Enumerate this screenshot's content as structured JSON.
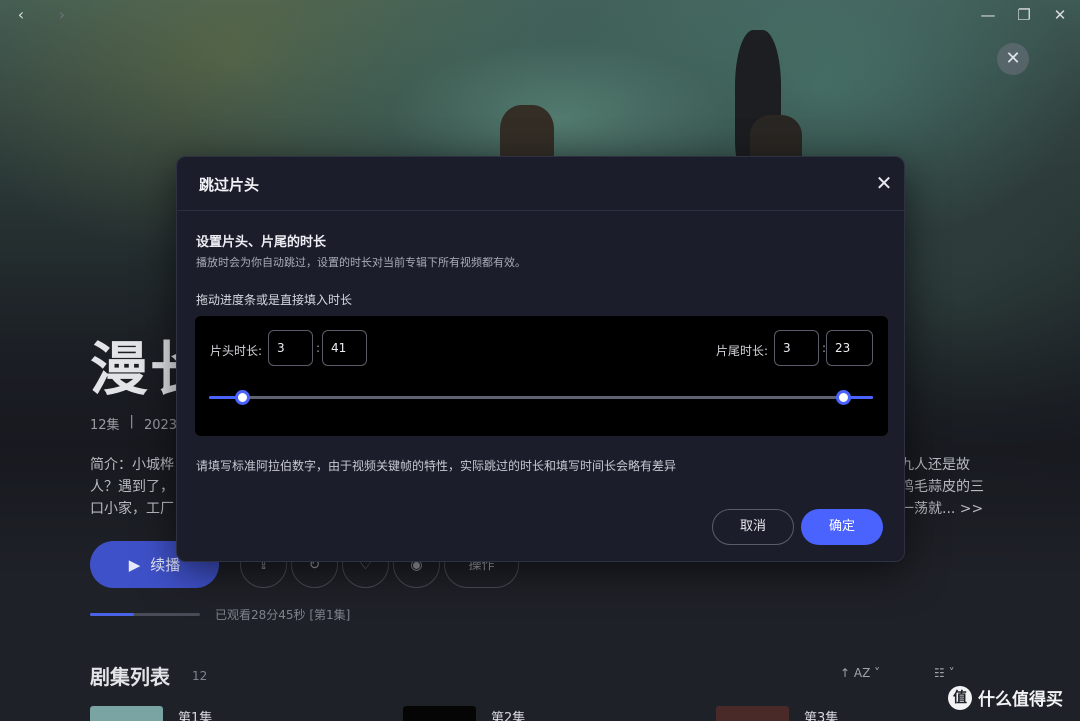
{
  "window": {
    "back_icon": "‹",
    "forward_icon": "›",
    "minimize_icon": "—",
    "restore_icon": "❐",
    "close_icon": "✕"
  },
  "page": {
    "close_icon": "✕",
    "title": "漫长",
    "meta": [
      "12集",
      "|",
      "2023年"
    ],
    "description": "简介：小城桦\n人？遇到了，\n口小家，工厂",
    "description_right": "九人还是故\n鸡毛蒜皮的三\n一荡就... >>",
    "play_label": "续播",
    "action_pill": "操作",
    "watched_text": "已观看28分45秒 [第1集]",
    "progress": 0.4,
    "episodes_heading": "剧集列表",
    "episodes_count": "12",
    "sort_label": "↑ AZ ˅",
    "view_label": "☷ ˅",
    "episodes": [
      "第1集",
      "第2集",
      "第3集"
    ]
  },
  "watermark": {
    "badge": "值",
    "text": "什么值得买"
  },
  "modal": {
    "title": "跳过片头",
    "close_icon": "✕",
    "section_title": "设置片头、片尾的时长",
    "section_desc": "播放时会为你自动跳过，设置的时长对当前专辑下所有视频都有效。",
    "drag_hint": "拖动进度条或是直接填入时长",
    "intro_label": "片头时长:",
    "intro_min": "3",
    "intro_sec": "41",
    "outro_label": "片尾时长:",
    "outro_min": "3",
    "outro_sec": "23",
    "colon": ":",
    "slider_start": 0.05,
    "slider_end": 0.955,
    "note": "请填写标准阿拉伯数字，由于视频关键帧的特性，实际跳过的时长和填写时间长会略有差异",
    "cancel_label": "取消",
    "ok_label": "确定"
  },
  "colors": {
    "accent": "#4a63ff",
    "modal_bg": "#1b1d2b",
    "panel_bg": "#000000"
  }
}
